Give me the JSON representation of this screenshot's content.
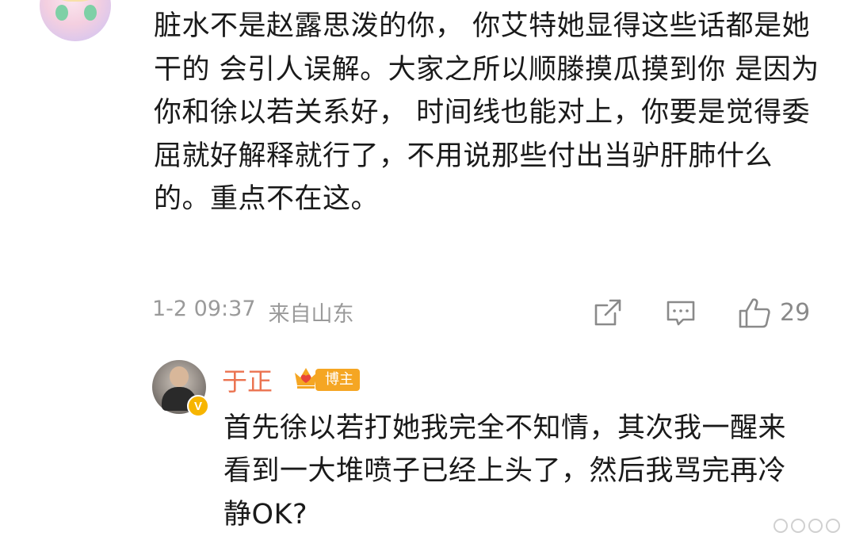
{
  "top_comment": {
    "text": "脏水不是赵露思泼的你， 你艾特她显得这些话都是她干的 会引人误解。大家之所以顺滕摸瓜摸到你 是因为你和徐以若关系好， 时间线也能对上，你要是觉得委屈就好解释就行了，不用说那些付出当驴肝肺什么的。重点不在这。",
    "time": "1-2 09:37",
    "location": "来自山东",
    "like_count": "29",
    "icons": [
      "share-icon",
      "comment-icon",
      "like-icon"
    ]
  },
  "reply": {
    "username": "于正",
    "badge": "博主",
    "verified_icon": "V",
    "text": "首先徐以若打她我完全不知情，其次我一醒来看到一大堆喷子已经上头了，然后我骂完再冷静OK?"
  },
  "colors": {
    "username": "#eb7350",
    "meta": "#9a9a9a",
    "badge": "#f5a623",
    "text": "#1a1a1a"
  }
}
